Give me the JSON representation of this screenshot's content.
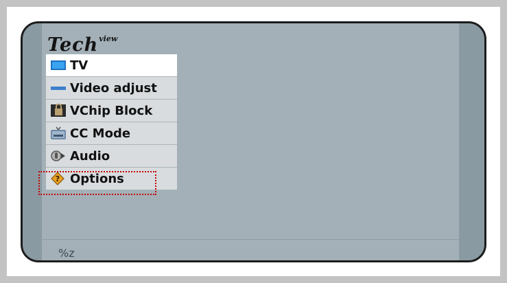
{
  "logo": {
    "main": "Tech",
    "sup": "view"
  },
  "menu": {
    "items": [
      {
        "label": "TV",
        "icon": "tv-icon"
      },
      {
        "label": "Video adjust",
        "icon": "video-adjust-icon"
      },
      {
        "label": "VChip Block",
        "icon": "vchip-lock-icon"
      },
      {
        "label": "CC Mode",
        "icon": "cc-mode-icon"
      },
      {
        "label": "Audio",
        "icon": "audio-icon"
      },
      {
        "label": "Options",
        "icon": "options-icon"
      }
    ],
    "active_index": 0,
    "focused_index": 5
  },
  "footer": {
    "text": "%z"
  },
  "colors": {
    "frame": "#c3c3c3",
    "screen": "#a3b0b7",
    "screen_edge": "#8a9aa2",
    "menu_bg": "#d8dcdf",
    "menu_active": "#ffffff",
    "focus": "#c40000",
    "tv_icon": "#2f8fe0"
  }
}
